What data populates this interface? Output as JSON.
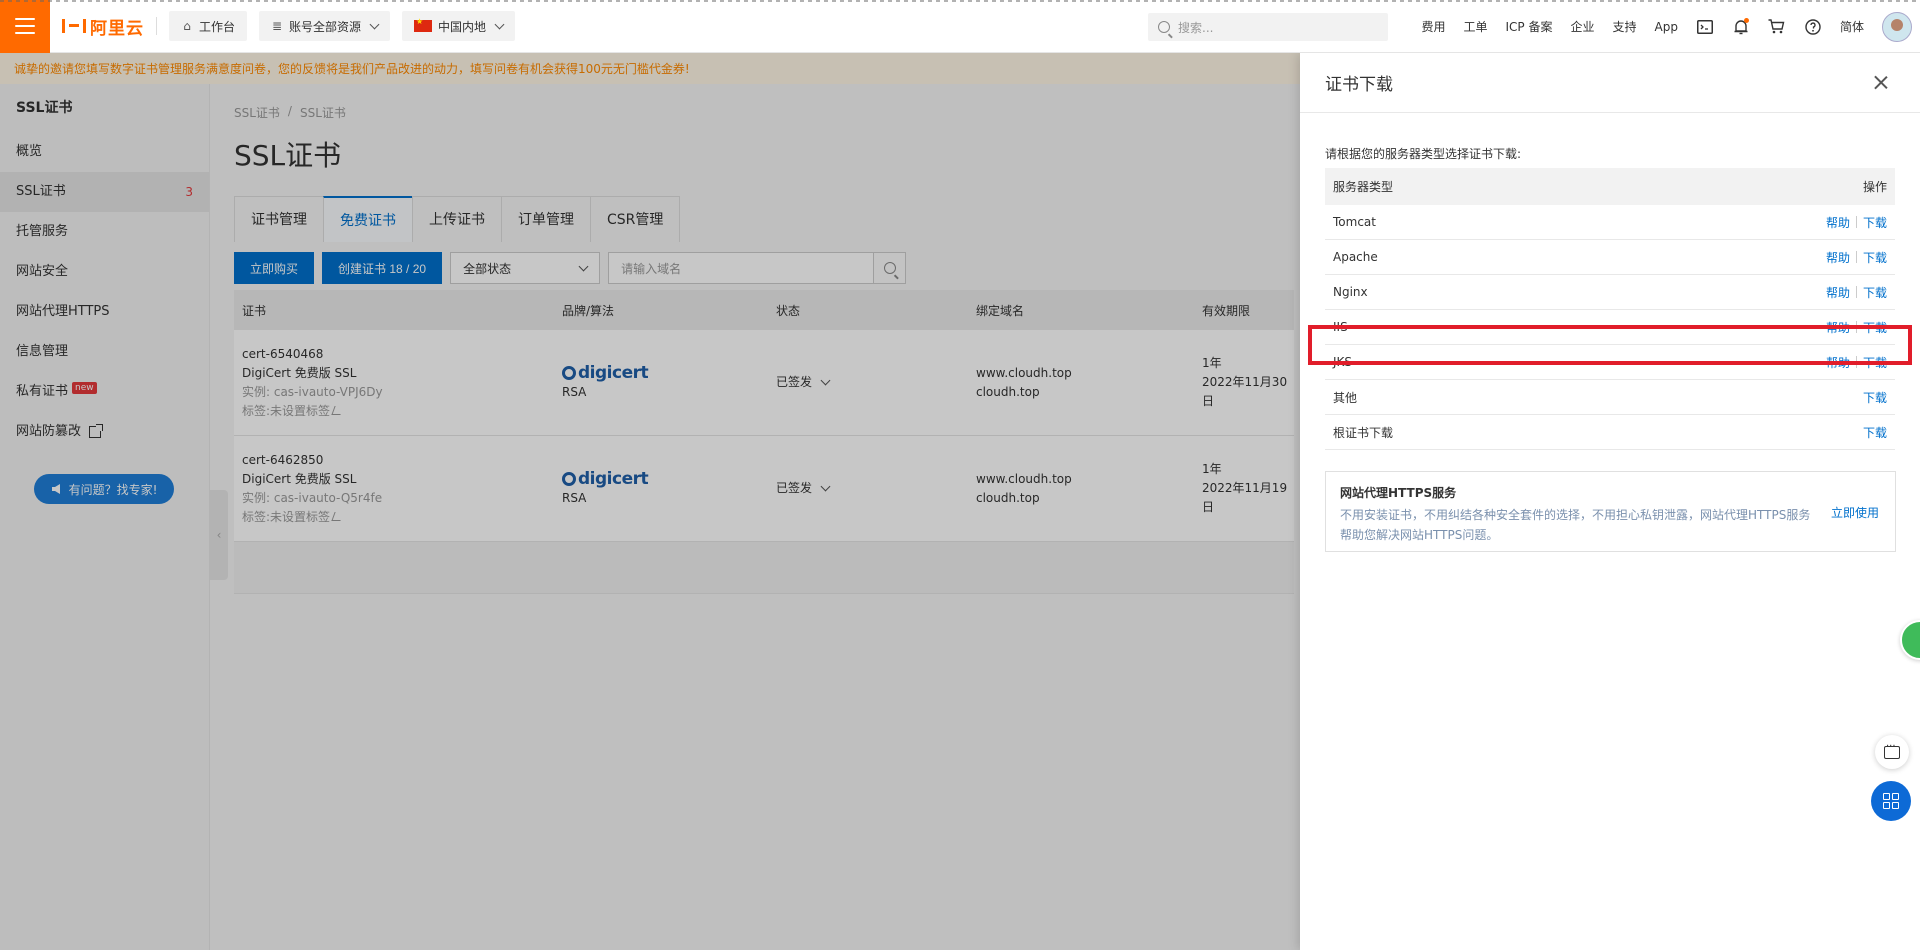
{
  "topbar": {
    "brand": "阿里云",
    "workbench": "工作台",
    "resources": "账号全部资源",
    "region": "中国内地",
    "search_placeholder": "搜索...",
    "links": [
      "费用",
      "工单",
      "ICP 备案",
      "企业",
      "支持",
      "App"
    ],
    "lang": "简体"
  },
  "notice": "诚挚的邀请您填写数字证书管理服务满意度问卷，您的反馈将是我们产品改进的动力，填写问卷有机会获得100元无门槛代金券!",
  "sidebar": {
    "title": "SSL证书",
    "items": [
      {
        "label": "概览"
      },
      {
        "label": "SSL证书",
        "count": "3"
      },
      {
        "label": "托管服务"
      },
      {
        "label": "网站安全"
      },
      {
        "label": "网站代理HTTPS"
      },
      {
        "label": "信息管理"
      },
      {
        "label": "私有证书",
        "badge": "new"
      },
      {
        "label": "网站防篡改"
      }
    ],
    "expert_button": "有问题？找专家!"
  },
  "main": {
    "breadcrumb": [
      "SSL证书",
      "/",
      "SSL证书"
    ],
    "title": "SSL证书",
    "tabs": [
      "证书管理",
      "免费证书",
      "上传证书",
      "订单管理",
      "CSR管理"
    ],
    "buy_button": "立即购买",
    "create_button": "创建证书 18 / 20",
    "status_select": "全部状态",
    "domain_placeholder": "请输入域名",
    "columns": [
      "证书",
      "品牌/算法",
      "状态",
      "绑定域名",
      "有效期限"
    ],
    "rows": [
      {
        "id": "cert-6540468",
        "product": "DigiCert 免费版 SSL",
        "instance": "实例: cas-ivauto-VPJ6Dy",
        "tag": "标签:未设置标签",
        "brand": "digicert",
        "algo": "RSA",
        "status": "已签发",
        "domain1": "www.cloudh.top",
        "domain2": "cloudh.top",
        "period": "1年",
        "expire": "2022年11月30日"
      },
      {
        "id": "cert-6462850",
        "product": "DigiCert 免费版 SSL",
        "instance": "实例: cas-ivauto-Q5r4fe",
        "tag": "标签:未设置标签",
        "brand": "digicert",
        "algo": "RSA",
        "status": "已签发",
        "domain1": "www.cloudh.top",
        "domain2": "cloudh.top",
        "period": "1年",
        "expire": "2022年11月19日"
      }
    ]
  },
  "drawer": {
    "title": "证书下载",
    "description": "请根据您的服务器类型选择证书下载:",
    "col_server": "服务器类型",
    "col_action": "操作",
    "help": "帮助",
    "download": "下载",
    "servers": [
      {
        "name": "Tomcat",
        "help": true
      },
      {
        "name": "Apache",
        "help": true
      },
      {
        "name": "Nginx",
        "help": true
      },
      {
        "name": "IIS",
        "help": true
      },
      {
        "name": "JKS",
        "help": true
      },
      {
        "name": "其他",
        "help": false
      },
      {
        "name": "根证书下载",
        "help": false
      }
    ],
    "https_title": "网站代理HTTPS服务",
    "https_text": "不用安装证书，不用纠结各种安全套件的选择，不用担心私钥泄露，网站代理HTTPS服务帮助您解决网站HTTPS问题。",
    "https_link": "立即使用"
  },
  "colors": {
    "brand_orange": "#ff6a00",
    "primary_blue": "#0070cc",
    "highlight_red": "#e11d2a"
  }
}
